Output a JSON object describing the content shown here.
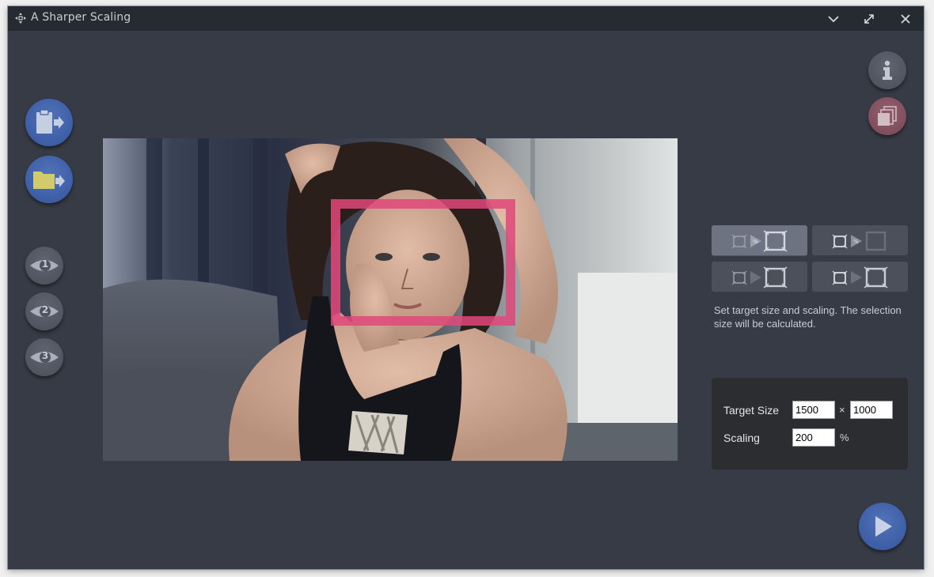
{
  "window": {
    "title": "A Sharper Scaling",
    "controls": [
      "chevron-down-icon",
      "maximize-icon",
      "close-icon"
    ]
  },
  "left_toolbar": {
    "paste_button": "clipboard-arrow-icon",
    "open_button": "folder-arrow-icon",
    "preview_buttons": [
      {
        "label": "1",
        "icon": "eye-icon"
      },
      {
        "label": "2",
        "icon": "eye-icon"
      },
      {
        "label": "3",
        "icon": "eye-icon"
      }
    ]
  },
  "right_toolbar": {
    "info_button": "info-icon",
    "batch_button": "stacked-pages-icon"
  },
  "modes": {
    "buttons": [
      {
        "name": "target-size-and-scaling",
        "active": true,
        "percent_glyph": "%"
      },
      {
        "name": "selection-size-and-scaling",
        "active": false,
        "percent_glyph": "%"
      },
      {
        "name": "selection-to-target-size",
        "active": false
      },
      {
        "name": "selection-to-target-size-alt",
        "active": false
      }
    ],
    "hint": "Set target size and scaling. The selection size will be calculated."
  },
  "settings": {
    "target_size_label": "Target Size",
    "width": "1500",
    "times": "×",
    "height": "1000",
    "scaling_label": "Scaling",
    "scaling": "200",
    "percent": "%"
  },
  "colors": {
    "background": "#373b45",
    "titlebar": "#262a31",
    "accent_blue": "#3d5ea6",
    "selection": "#e0487a",
    "panel": "#2b2d31"
  },
  "start_button": "play-icon"
}
